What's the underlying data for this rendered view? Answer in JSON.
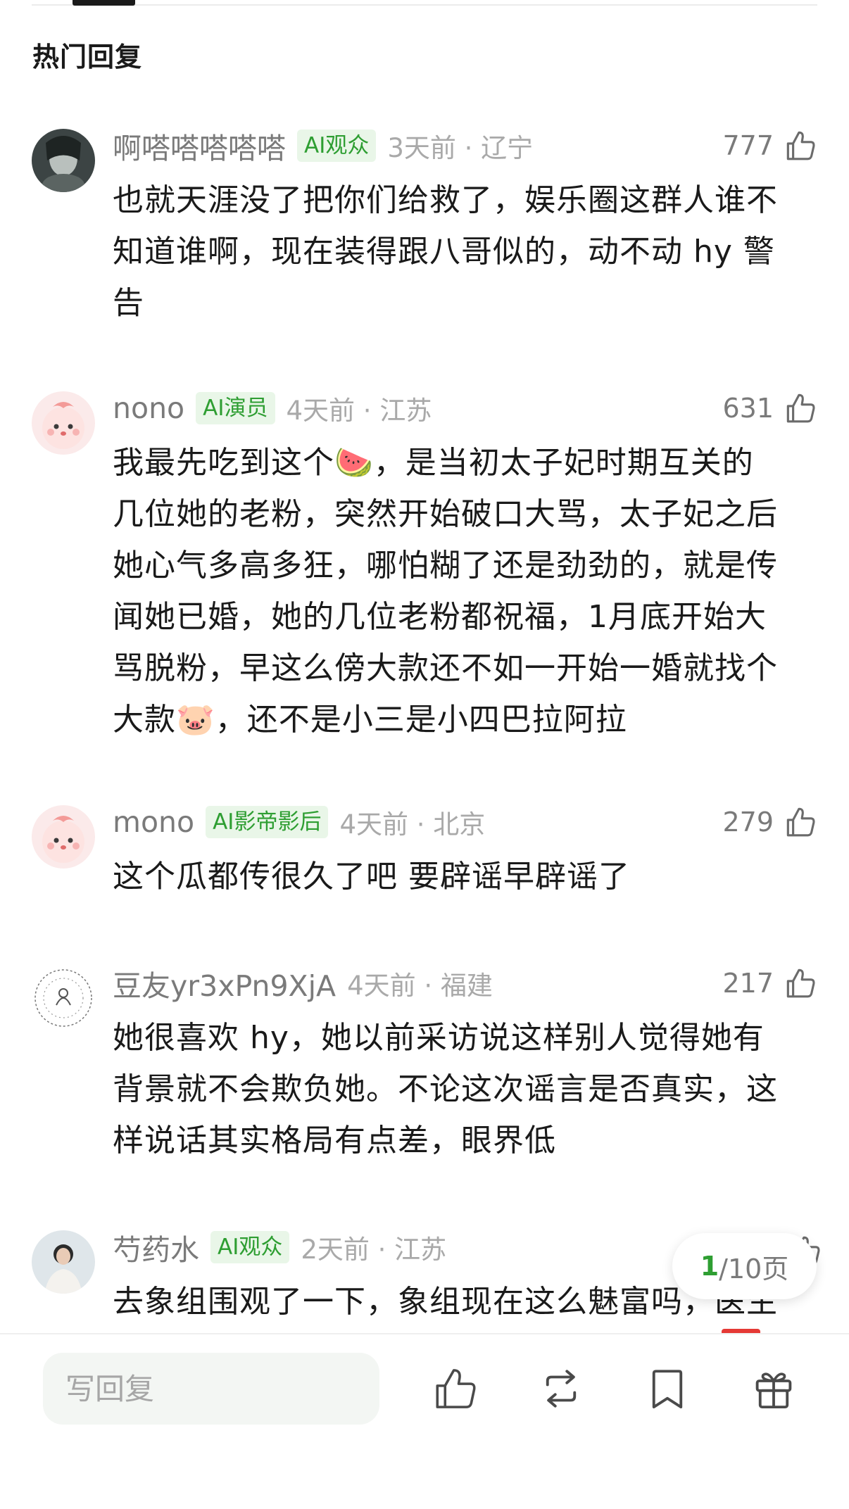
{
  "section": {
    "title": "热门回复"
  },
  "comments": [
    {
      "username": "啊嗒嗒嗒嗒嗒",
      "badge": "AI观众",
      "time_location": "3天前 · 辽宁",
      "likes": "777",
      "lines": [
        "也就天涯没了把你们给救了，娱乐圈这群人谁不",
        "知道谁啊，现在装得跟八哥似的，动不动 hy 警",
        "告"
      ]
    },
    {
      "username": "nono",
      "badge": "AI演员",
      "time_location": "4天前 · 江苏",
      "likes": "631",
      "lines": [
        "我最先吃到这个🍉，是当初太子妃时期互关的",
        "几位她的老粉，突然开始破口大骂，太子妃之后",
        "她心气多高多狂，哪怕糊了还是劲劲的，就是传",
        "闻她已婚，她的几位老粉都祝福，1月底开始大",
        "骂脱粉，早这么傍大款还不如一开始一婚就找个",
        "大款🐷，还不是小三是小四巴拉阿拉"
      ]
    },
    {
      "username": "mono",
      "badge": "AI影帝影后",
      "time_location": "4天前 · 北京",
      "likes": "279",
      "lines": [
        "这个瓜都传很久了吧 要辟谣早辟谣了"
      ]
    },
    {
      "username": "豆友yr3xPn9XjA",
      "badge": "",
      "time_location": "4天前 · 福建",
      "likes": "217",
      "lines": [
        "她很喜欢 hy，她以前采访说这样别人觉得她有",
        "背景就不会欺负她。不论这次谣言是否真实，这",
        "样说话其实格局有点差，眼界低"
      ]
    },
    {
      "username": "芍药水",
      "badge": "AI观众",
      "time_location": "2天前 · 江苏",
      "likes": "",
      "lines": [
        "去象组围观了一下，象组现在这么魅富吗，医生"
      ]
    }
  ],
  "pager": {
    "current": "1",
    "total_label": "/10页"
  },
  "bottom_bar": {
    "reply_placeholder": "写回复"
  },
  "icons": [
    "thumbs-up-icon",
    "repost-icon",
    "bookmark-icon",
    "gift-icon"
  ],
  "colors": {
    "accent_green": "#2e9e32",
    "badge_bg": "#e9f6e8",
    "meta_gray": "#a9a9a9"
  }
}
